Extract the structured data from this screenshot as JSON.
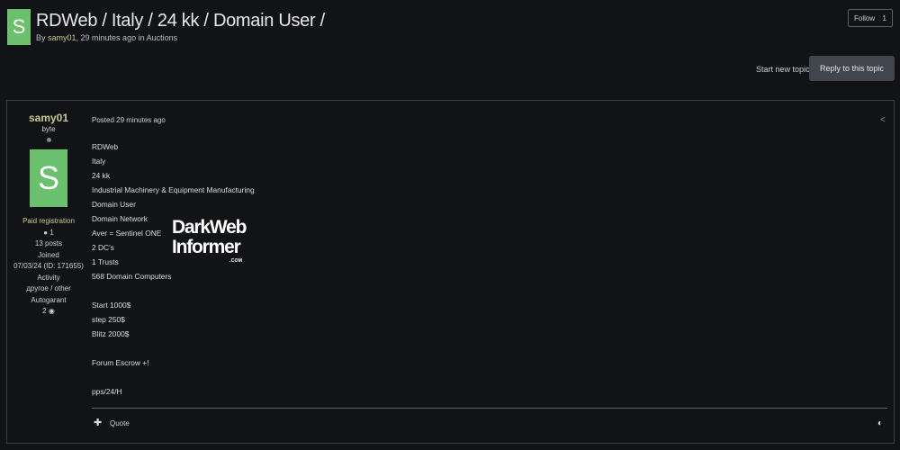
{
  "header": {
    "avatar_letter": "S",
    "title": "RDWeb / Italy / 24 kk / Domain User /",
    "byline_prefix": "By ",
    "author": "samy01",
    "byline_suffix": ", 29 minutes ago in Auctions"
  },
  "follow": {
    "label": "Follow",
    "count": "1"
  },
  "actions": {
    "start_new_topic": "Start new topic",
    "reply": "Reply to this topic"
  },
  "author_panel": {
    "name": "samy01",
    "rank": "byte",
    "avatar_letter": "S",
    "group": "Paid registration",
    "reputation": "1",
    "posts": "13 posts",
    "joined_label": "Joined",
    "joined_value": "07/03/24 (ID: 171655)",
    "activity_label": "Activity",
    "activity_value": "другое / other",
    "autogarant_label": "Autogarant",
    "autogarant_value": "2"
  },
  "post": {
    "posted": "Posted 29 minutes ago",
    "lines": [
      "RDWeb",
      "Italy",
      "24 kk",
      "Industrial Machinery & Equipment Manufacturing",
      "Domain User",
      "Domain Network",
      "Aver = Sentinel ONE",
      "2 DC's",
      "1 Trusts",
      "568 Domain Computers",
      "",
      "Start 1000$",
      "step 250$",
      "Blitz 2000$",
      "",
      "Forum Escrow +!",
      "",
      "pps/24/H"
    ]
  },
  "watermark": {
    "line1": "DarkWeb",
    "line2": "Informer",
    "line3": ".COM"
  },
  "footer": {
    "quote": "Quote"
  },
  "icons": {
    "share": "share-icon",
    "plus": "plus-icon",
    "theme": "moon-icon",
    "reputation": "reputation-icon",
    "autogarant": "handshake-icon"
  },
  "colors": {
    "background": "#121317",
    "accent_green": "#6bc06e",
    "author_color": "#c8c890",
    "button_bg": "#41464d"
  }
}
